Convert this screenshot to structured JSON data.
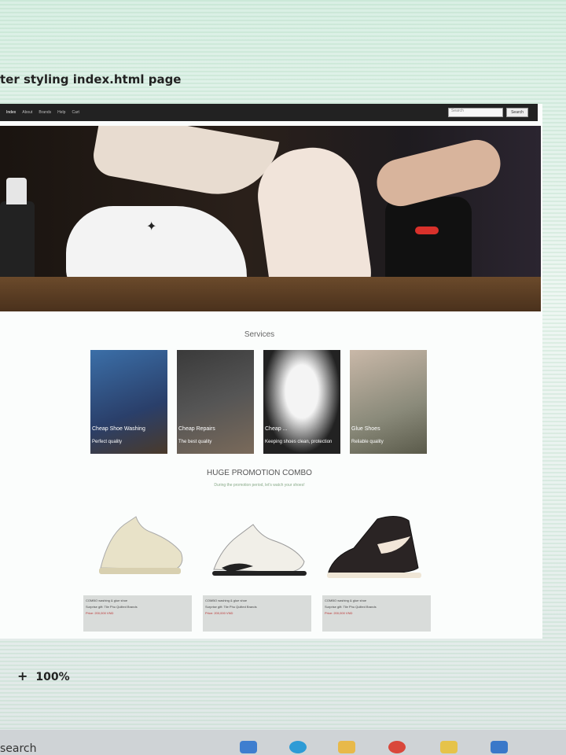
{
  "document": {
    "title": "ter styling index.html page"
  },
  "navbar": {
    "items": [
      "Index",
      "About",
      "Brands",
      "Help",
      "Cart"
    ],
    "active_index": 0,
    "search_placeholder": "Search",
    "search_button": "Search"
  },
  "services": {
    "title": "Services",
    "cards": [
      {
        "label": "Cheap Shoe Washing",
        "sub": "Perfect quality"
      },
      {
        "label": "Cheap Repairs",
        "sub": "The best quality"
      },
      {
        "label": "Cheap ...",
        "sub": "Keeping shoes clean, protection"
      },
      {
        "label": "Glue Shoes",
        "sub": "Reliable quality"
      }
    ]
  },
  "promotion": {
    "title": "HUGE PROMOTION COMBO",
    "subtitle": "During the promotion period, let's watch your shoes!",
    "products": [
      {
        "name": "COMBO washing & glue shoe",
        "detail": "Surprise gift: Tile Phu Quilted Brands",
        "price": "Price: 200,000 VND"
      },
      {
        "name": "COMBO washing & glue shoe",
        "detail": "Surprise gift: Tile Phu Quilted Brands",
        "price": "Price: 200,000 VND"
      },
      {
        "name": "COMBO washing & glue shoe",
        "detail": "Surprise gift: Tile Phu Quilted Brands",
        "price": "Price: 200,000 VND"
      }
    ]
  },
  "zoom": {
    "plus": "+",
    "level": "100%"
  },
  "taskbar": {
    "search_text": "search"
  }
}
